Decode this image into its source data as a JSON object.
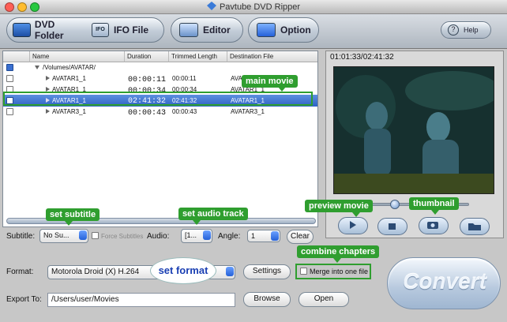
{
  "window": {
    "title": "Pavtube DVD Ripper"
  },
  "toolbar": {
    "dvd_folder": "DVD Folder",
    "ifo_file": "IFO File",
    "editor": "Editor",
    "option": "Option",
    "help": "Help"
  },
  "list": {
    "headers": [
      "Name",
      "Duration",
      "Trimmed Length",
      "Destination File"
    ],
    "root": "/Volumes/AVATAR/",
    "rows": [
      {
        "name": "AVATAR1_1",
        "duration": "00:00:11",
        "trimmed": "00:00:11",
        "dest": "AVATAR1_1",
        "checked": false
      },
      {
        "name": "AVATAR1_1",
        "duration": "00:00:34",
        "trimmed": "00:00:34",
        "dest": "AVATAR1_1",
        "checked": false
      },
      {
        "name": "AVATAR1_1",
        "duration": "02:41:32",
        "trimmed": "02:41:32",
        "dest": "AVATAR1_1",
        "checked": true
      },
      {
        "name": "AVATAR3_1",
        "duration": "00:00:43",
        "trimmed": "00:00:43",
        "dest": "AVATAR3_1",
        "checked": false
      }
    ]
  },
  "callouts": {
    "main_movie": "main movie",
    "set_subtitle": "set subtitle",
    "set_audio_track": "set audio track",
    "preview_movie": "preview movie",
    "thumbnail": "thumbnail",
    "combine_chapters": "combine chapters",
    "set_format": "set format"
  },
  "controls": {
    "subtitle_label": "Subtitle:",
    "subtitle_value": "No Su...",
    "force_subtitles": "Force Subtitles",
    "audio_label": "Audio:",
    "audio_value": "[1...",
    "angle_label": "Angle:",
    "angle_value": "1",
    "clear": "Clear"
  },
  "preview": {
    "timecode": "01:01:33/02:41:32"
  },
  "output": {
    "format_label": "Format:",
    "format_value": "Motorola Droid (X) H.264",
    "settings": "Settings",
    "merge": "Merge into one file",
    "export_label": "Export To:",
    "export_value": "/Users/user/Movies",
    "browse": "Browse",
    "open": "Open",
    "convert": "Convert"
  },
  "colors": {
    "accent_blue": "#2d62c4",
    "callout_green": "#2f9e2f",
    "highlight_yellow": "#fff36a"
  }
}
